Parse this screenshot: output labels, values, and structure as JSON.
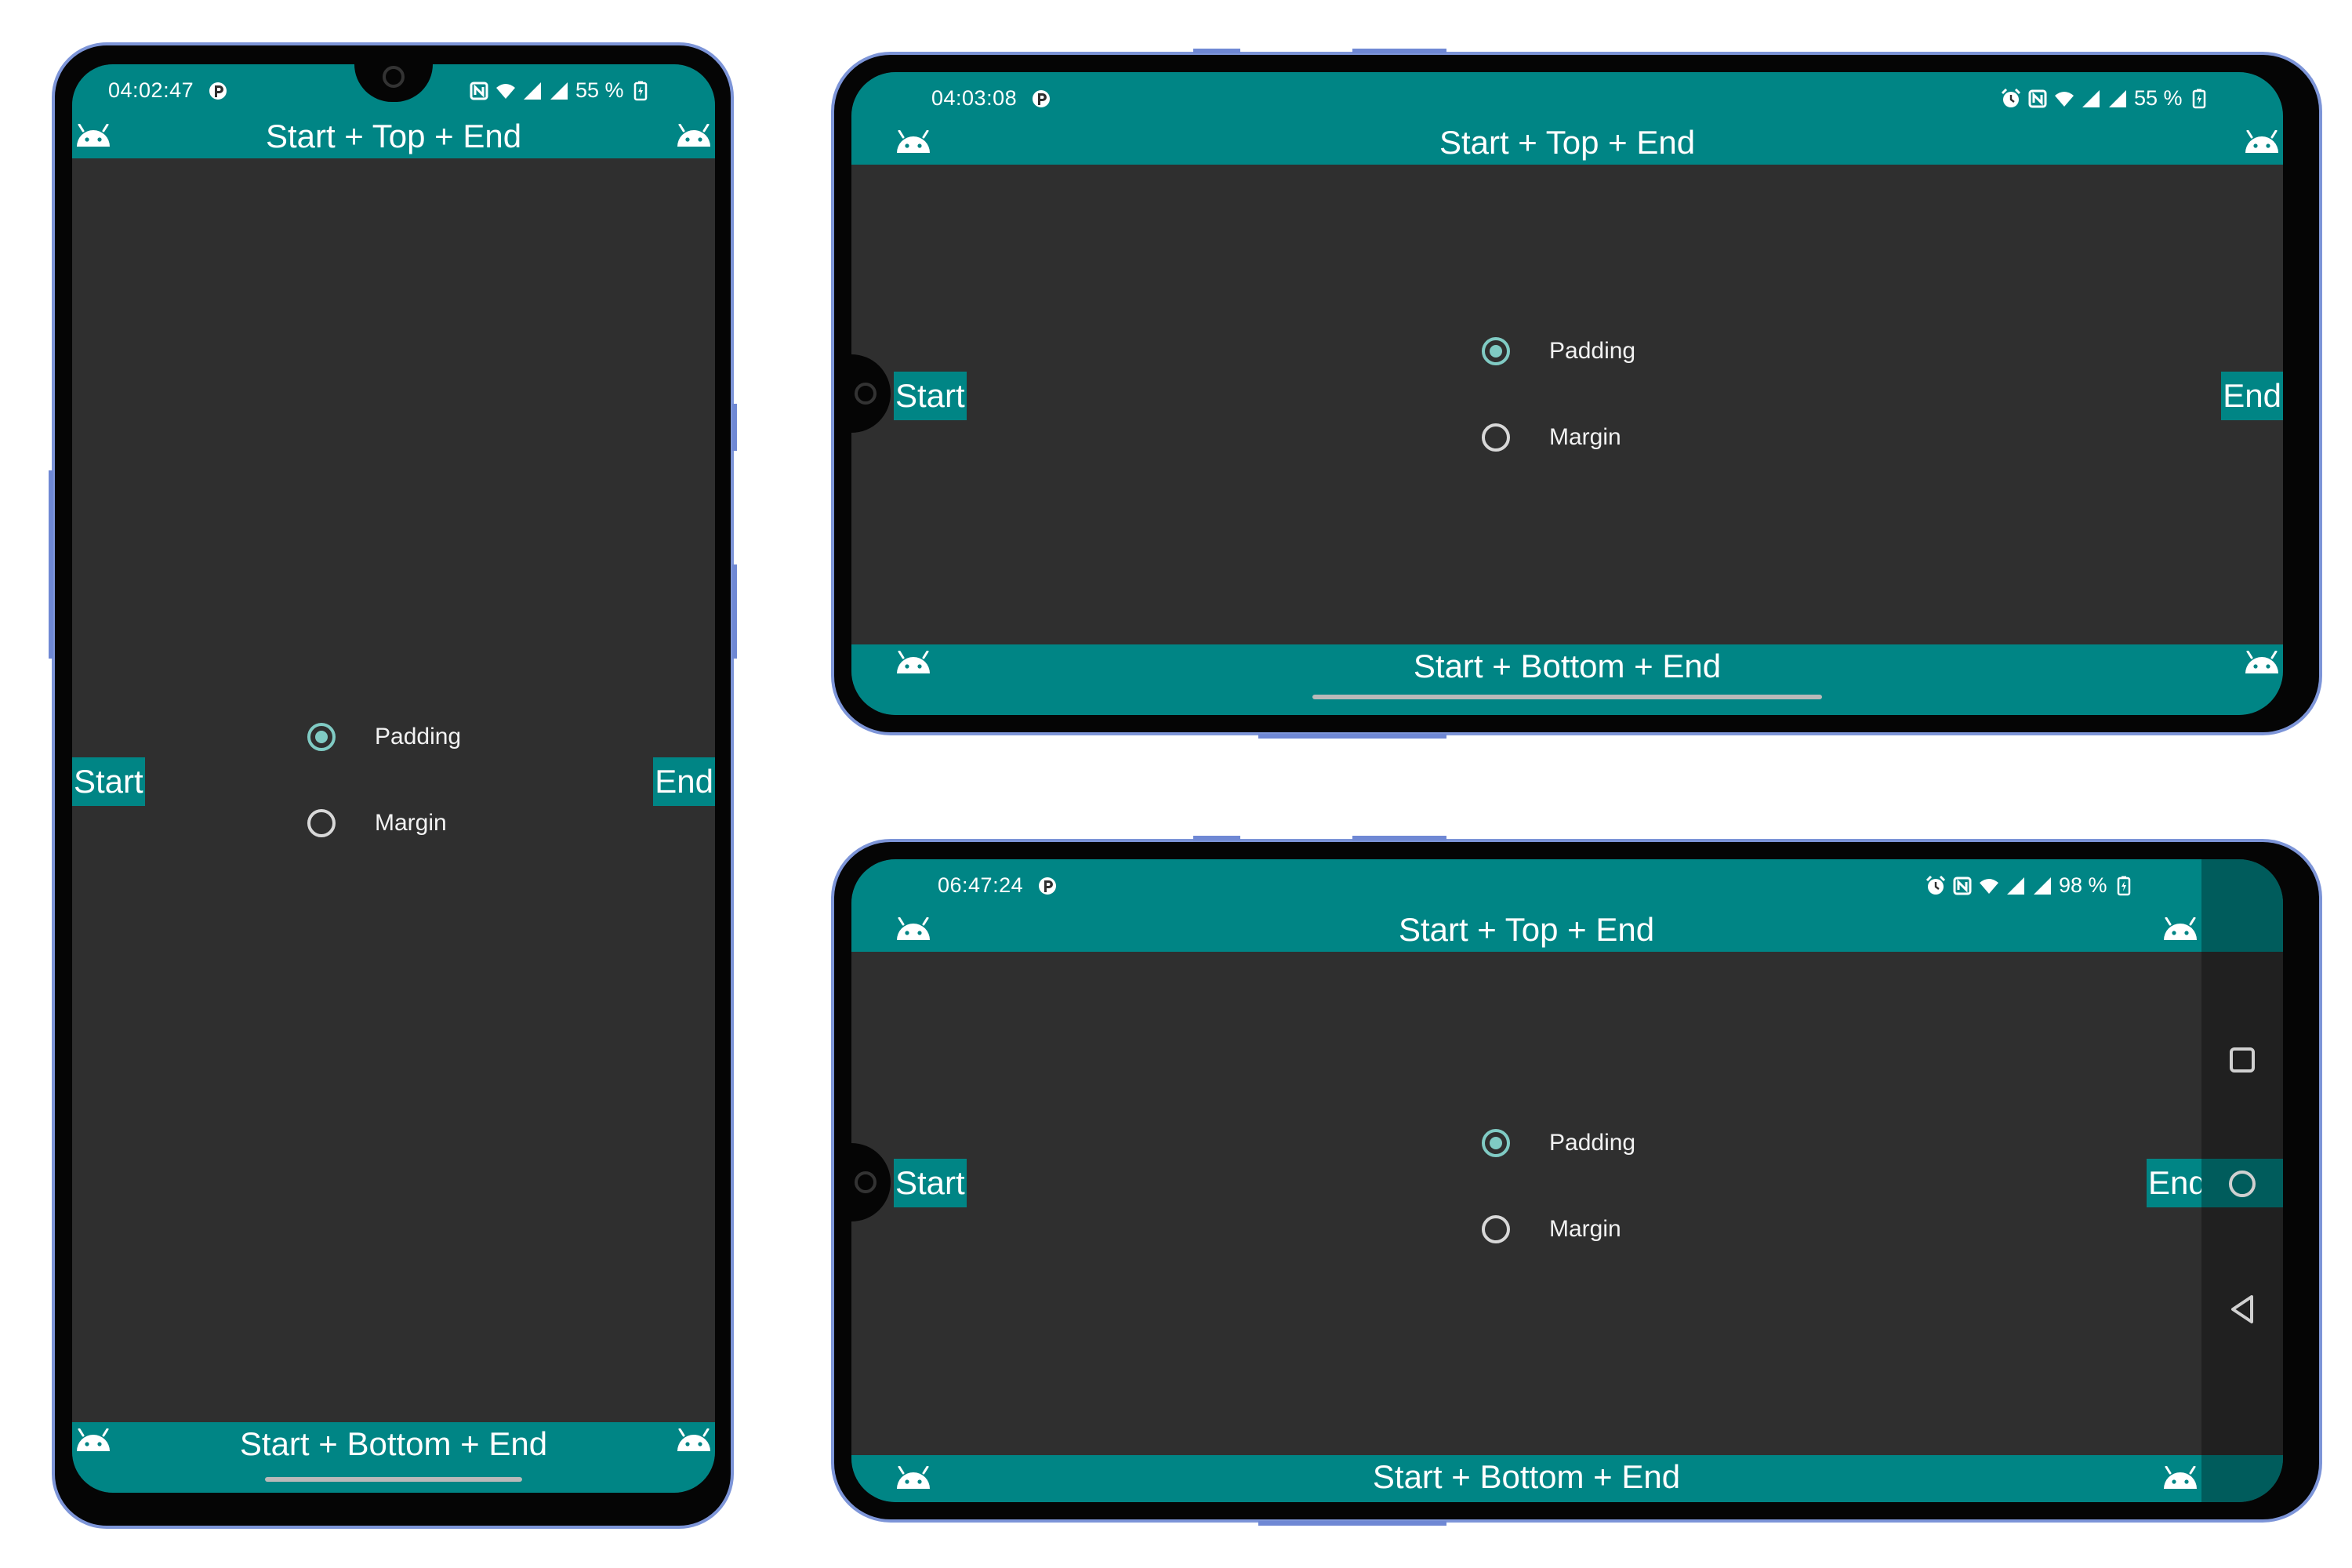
{
  "colors": {
    "teal": "#008585",
    "screen_bg": "#2f2f2f",
    "frame": "#050505",
    "frame_outline": "#7d95d8",
    "radio_accent": "#80cbc4"
  },
  "portrait": {
    "time": "04:02:47",
    "battery": "55 %",
    "top_bar": "Start + Top + End",
    "bottom_bar": "Start + Bottom + End",
    "start_label": "Start",
    "end_label": "End",
    "radio_padding": "Padding",
    "radio_margin": "Margin"
  },
  "landscape_gesture": {
    "time": "04:03:08",
    "battery": "55 %",
    "top_bar": "Start + Top + End",
    "bottom_bar": "Start + Bottom + End",
    "start_label": "Start",
    "end_label": "End",
    "radio_padding": "Padding",
    "radio_margin": "Margin"
  },
  "landscape_nav": {
    "time": "06:47:24",
    "battery": "98 %",
    "top_bar": "Start + Top + End",
    "bottom_bar": "Start + Bottom + End",
    "start_label": "Start",
    "end_label": "End",
    "radio_padding": "Padding",
    "radio_margin": "Margin",
    "nav_buttons": [
      "recents-icon",
      "home-icon",
      "back-icon"
    ]
  },
  "selected_radio": "Padding"
}
